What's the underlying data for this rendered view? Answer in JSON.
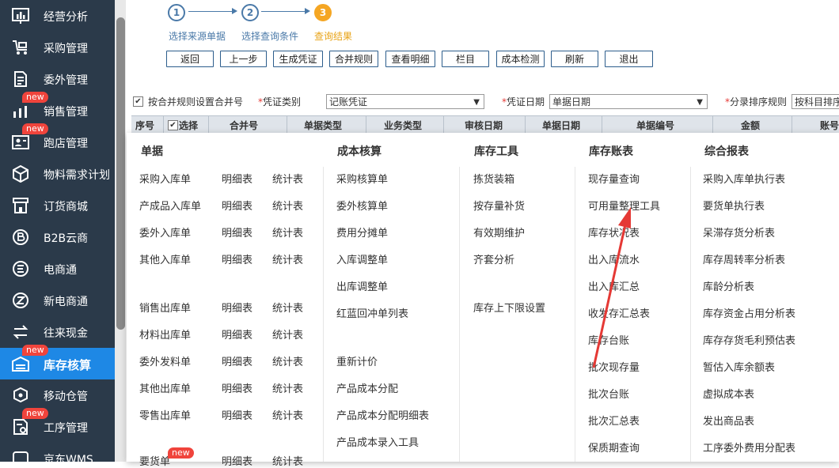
{
  "sidebar": {
    "items": [
      {
        "label": "经营分析",
        "icon": "chart-icon",
        "badge": ""
      },
      {
        "label": "采购管理",
        "icon": "cart-icon",
        "badge": ""
      },
      {
        "label": "委外管理",
        "icon": "document-icon",
        "badge": ""
      },
      {
        "label": "销售管理",
        "icon": "bar-chart-icon",
        "badge": "new"
      },
      {
        "label": "跑店管理",
        "icon": "person-card-icon",
        "badge": "new"
      },
      {
        "label": "物料需求计划",
        "icon": "cube-icon",
        "badge": ""
      },
      {
        "label": "订货商城",
        "icon": "store-icon",
        "badge": ""
      },
      {
        "label": "B2B云商",
        "icon": "b2b-icon",
        "badge": ""
      },
      {
        "label": "电商通",
        "icon": "e-commerce-icon",
        "badge": ""
      },
      {
        "label": "新电商通",
        "icon": "new-e-commerce-icon",
        "badge": ""
      },
      {
        "label": "往来现金",
        "icon": "exchange-icon",
        "badge": ""
      },
      {
        "label": "库存核算",
        "icon": "warehouse-icon",
        "badge": "new"
      },
      {
        "label": "移动仓管",
        "icon": "mobile-cube-icon",
        "badge": ""
      },
      {
        "label": "工序管理",
        "icon": "process-icon",
        "badge": "new"
      },
      {
        "label": "京东WMS",
        "icon": "jd-icon",
        "badge": ""
      }
    ]
  },
  "steps": {
    "items": [
      {
        "num": "1",
        "label": "选择来源单据"
      },
      {
        "num": "2",
        "label": "选择查询条件"
      },
      {
        "num": "3",
        "label": "查询结果"
      }
    ]
  },
  "toolbar": {
    "buttons": [
      "返回",
      "上一步",
      "生成凭证",
      "合并规则",
      "查看明细",
      "栏目",
      "成本检测",
      "刷新",
      "退出"
    ]
  },
  "options": {
    "merge_label": "按合并规则设置合并号",
    "voucher_type_label": "凭证类别",
    "voucher_type_value": "记账凭证",
    "voucher_date_label": "凭证日期",
    "voucher_date_value": "单据日期",
    "sort_label": "分录排序规则",
    "sort_value": "按科目排序"
  },
  "table": {
    "headers": [
      "序号",
      "选择",
      "合并号",
      "单据类型",
      "业务类型",
      "审核日期",
      "单据日期",
      "单据编号",
      "金额",
      "账号"
    ]
  },
  "menu": {
    "columns": [
      {
        "title": "单据"
      },
      {
        "title": "成本核算"
      },
      {
        "title": "库存工具"
      },
      {
        "title": "库存账表"
      },
      {
        "title": "综合报表"
      }
    ],
    "docs": [
      "采购入库单",
      "产成品入库单",
      "委外入库单",
      "其他入库单",
      "销售出库单",
      "材料出库单",
      "委外发料单",
      "其他出库单",
      "零售出库单",
      "要货单"
    ],
    "detail_label": "明细表",
    "stat_label": "统计表",
    "doc_badge": "new",
    "cost": [
      "采购核算单",
      "委外核算单",
      "费用分摊单",
      "入库调整单",
      "出库调整单",
      "红蓝回冲单列表",
      "重新计价",
      "产品成本分配",
      "产品成本分配明细表",
      "产品成本录入工具"
    ],
    "tools": [
      "拣货装箱",
      "按存量补货",
      "有效期维护",
      "齐套分析",
      "库存上下限设置"
    ],
    "ledgers": [
      "现存量查询",
      "可用量整理工具",
      "库存状况表",
      "出入库流水",
      "出入库汇总",
      "收发存汇总表",
      "库存台账",
      "批次现存量",
      "批次台账",
      "批次汇总表",
      "保质期查询"
    ],
    "reports": [
      "采购入库单执行表",
      "要货单执行表",
      "呆滞存货分析表",
      "库存周转率分析表",
      "库龄分析表",
      "库存资金占用分析表",
      "库存存货毛利预估表",
      "暂估入库余额表",
      "虚拟成本表",
      "发出商品表",
      "工序委外费用分配表"
    ]
  },
  "colors": {
    "sidebar_bg": "#2b3a4a",
    "active_bg": "#1e88e5",
    "badge": "#f0443c",
    "step_current": "#f5a623",
    "annotation": "#e53935"
  }
}
